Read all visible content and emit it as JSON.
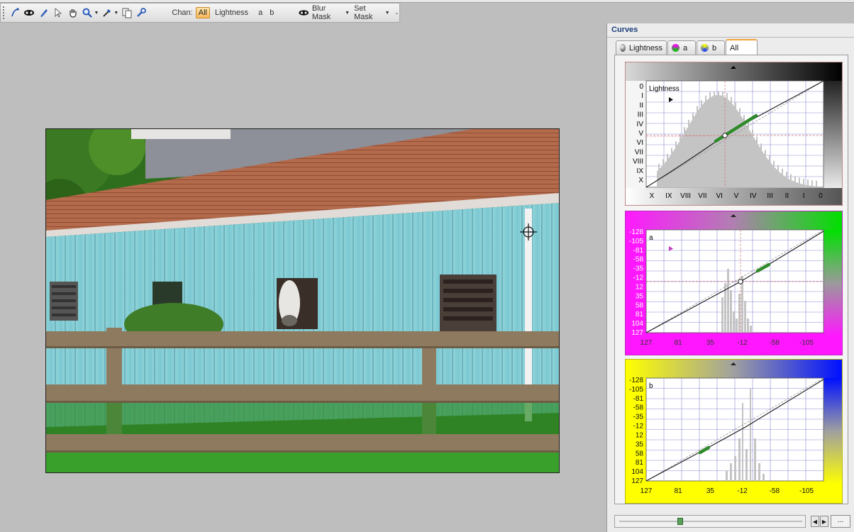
{
  "toolbar": {
    "chan_label": "Chan:",
    "channels": [
      "All",
      "Lightness",
      "a",
      "b"
    ],
    "active_channel": "All",
    "blur_mask": "Blur Mask",
    "set_mask": "Set Mask",
    "icons": [
      "curve-pointer-icon",
      "mask-icon",
      "pen-icon",
      "arrow-pointer-icon",
      "hand-icon",
      "zoom-icon",
      "eyedropper-icon",
      "copy-icon",
      "wrench-icon"
    ]
  },
  "panel": {
    "title": "Curves",
    "tabs": [
      "Lightness",
      "a",
      "b",
      "All"
    ],
    "active_tab": "All"
  },
  "graphs": {
    "lightness": {
      "label": "Lightness",
      "y_ticks": [
        "0",
        "I",
        "II",
        "III",
        "IV",
        "V",
        "VI",
        "VII",
        "VIII",
        "IX",
        "X"
      ],
      "x_ticks": [
        "X",
        "IX",
        "VIII",
        "VII",
        "VI",
        "V",
        "IV",
        "III",
        "II",
        "I",
        "0"
      ]
    },
    "a": {
      "label": "a",
      "y_ticks": [
        "-128",
        "-105",
        "-81",
        "-58",
        "-35",
        "-12",
        "12",
        "35",
        "58",
        "81",
        "104",
        "127"
      ],
      "x_ticks": [
        "127",
        "81",
        "35",
        "-12",
        "-58",
        "-105"
      ]
    },
    "b": {
      "label": "b",
      "y_ticks": [
        "-128",
        "-105",
        "-81",
        "-58",
        "-35",
        "-12",
        "12",
        "35",
        "58",
        "81",
        "104",
        "127"
      ],
      "x_ticks": [
        "127",
        "81",
        "35",
        "-12",
        "-58",
        "-105"
      ]
    }
  },
  "footer": {
    "more": "..."
  },
  "colors": {
    "accent": "#f3a43a",
    "panel_title": "#1a3d7a",
    "a_gradient_left": "#ff00ff",
    "a_gradient_right": "#00e000",
    "b_gradient_left": "#ffff00",
    "b_gradient_right": "#0000ff"
  }
}
